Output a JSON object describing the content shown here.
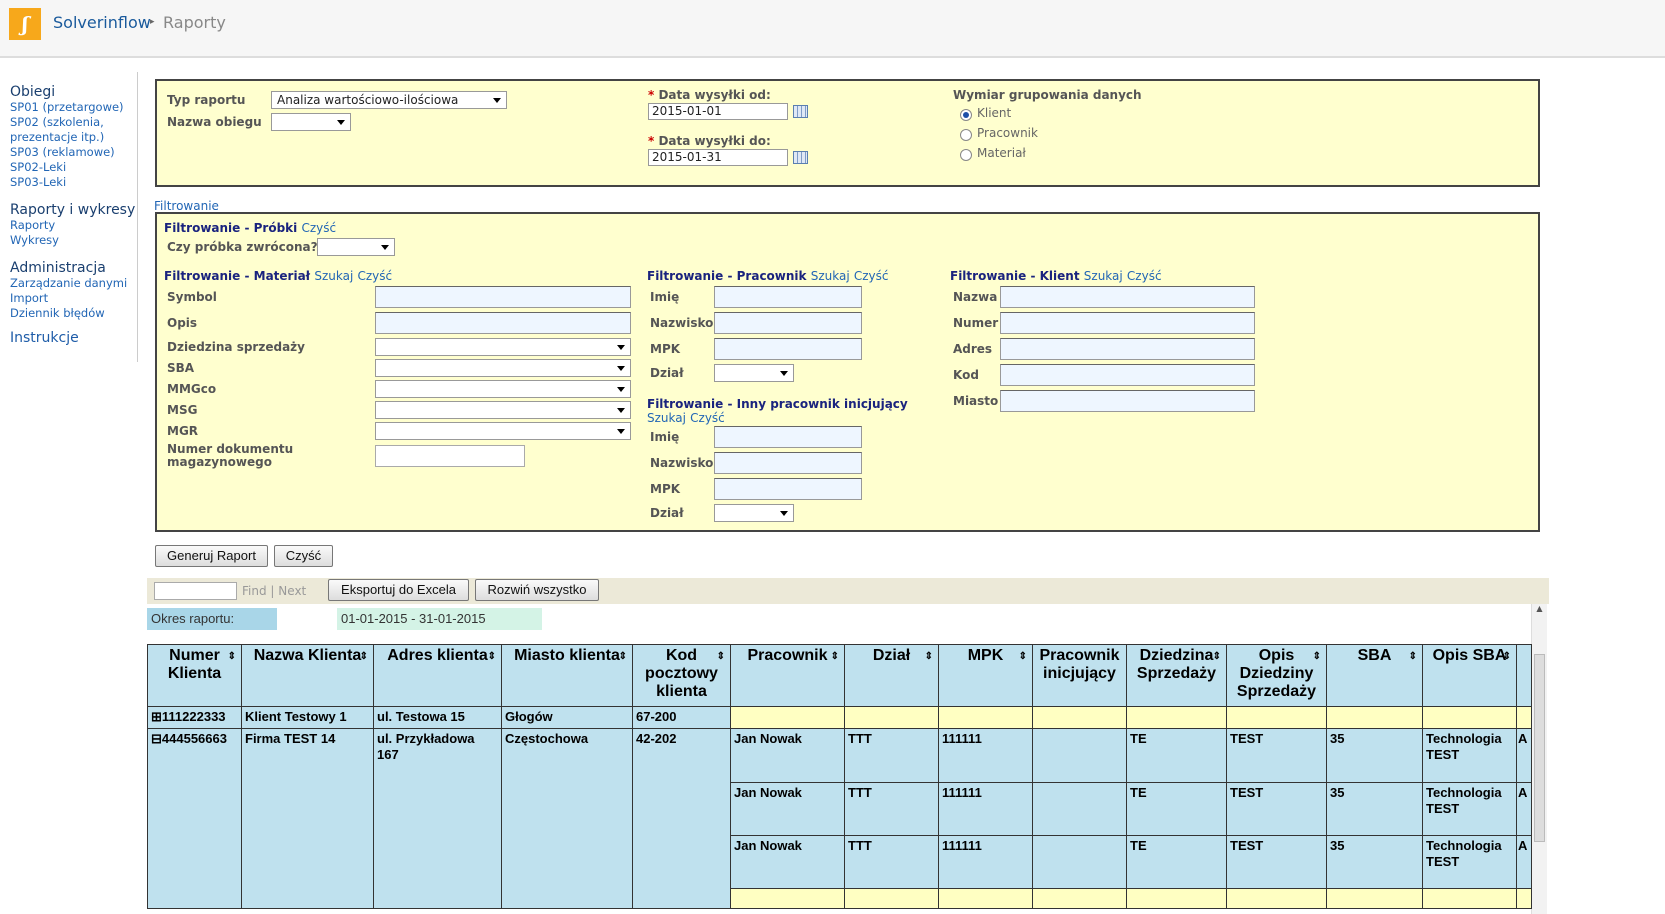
{
  "app": {
    "name": "Solverinflow",
    "page": "Raporty"
  },
  "nav": {
    "obiegi": {
      "title": "Obiegi",
      "items": [
        "SP01 (przetargowe)",
        "SP02 (szkolenia, prezentacje itp.)",
        "SP03 (reklamowe)",
        "SP02-Leki",
        "SP03-Leki"
      ]
    },
    "raporty": {
      "title": "Raporty i wykresy",
      "items": [
        "Raporty",
        "Wykresy"
      ]
    },
    "admin": {
      "title": "Administracja",
      "items": [
        "Zarządzanie danymi",
        "Import",
        "Dziennik błędów"
      ]
    },
    "instr": "Instrukcje"
  },
  "params": {
    "typ_label": "Typ raportu",
    "typ_value": "Analiza wartościowo-ilościowa",
    "nazwa_label": "Nazwa obiegu",
    "od_label": "Data wysyłki od:",
    "od_value": "2015-01-01",
    "do_label": "Data wysyłki do:",
    "do_value": "2015-01-31",
    "wym_label": "Wymiar grupowania danych",
    "radios": [
      "Klient",
      "Pracownik",
      "Materiał"
    ],
    "required_mark": "*"
  },
  "filter": {
    "toggle": "Filtrowanie",
    "probki": "Filtrowanie - Próbki",
    "clear": "Czyść",
    "search": "Szukaj",
    "zwrocona": "Czy próbka zwrócona?",
    "material": "Filtrowanie - Materiał",
    "mat_fields": [
      "Symbol",
      "Opis",
      "Dziedzina sprzedaży",
      "SBA",
      "MMGco",
      "MSG",
      "MGR",
      "Numer dokumentu magazynowego"
    ],
    "pracownik": "Filtrowanie - Pracownik",
    "prac_fields": [
      "Imię",
      "Nazwisko",
      "MPK",
      "Dział"
    ],
    "inny": "Filtrowanie - Inny pracownik inicjujący",
    "klient": "Filtrowanie - Klient",
    "kli_fields": [
      "Nazwa",
      "Numer",
      "Adres",
      "Kod",
      "Miasto"
    ]
  },
  "buttons": {
    "generate": "Generuj Raport",
    "clear": "Czyść",
    "export": "Eksportuj do Excela",
    "expand": "Rozwiń wszystko",
    "find": "Find",
    "next": "Next",
    "sep": "|"
  },
  "report": {
    "period_label": "Okres raportu:",
    "period_value": "01-01-2015 - 31-01-2015"
  },
  "table": {
    "columns": [
      "Numer Klienta",
      "Nazwa Klienta",
      "Adres klienta",
      "Miasto klienta",
      "Kod pocztowy klienta",
      "Pracownik",
      "Dział",
      "MPK",
      "Pracownik inicjujący",
      "Dziedzina Sprzedaży",
      "Opis Dziedziny Sprzedaży",
      "SBA",
      "Opis SBA"
    ],
    "sort_icon": "⇕",
    "rows": [
      {
        "toggle": "⊞",
        "numer": "111222333",
        "nazwa": "Klient Testowy 1",
        "adres": "ul. Testowa 15",
        "miasto": "Głogów",
        "kod": "67-200"
      },
      {
        "toggle": "⊟",
        "numer": "444556663",
        "nazwa": "Firma TEST 14",
        "adres": "ul. Przykładowa 167",
        "miasto": "Częstochowa",
        "kod": "42-202"
      }
    ],
    "detail": [
      {
        "prac": "Jan Nowak",
        "dzial": "TTT",
        "mpk": "111111",
        "inic": "",
        "dziedzina": "TE",
        "opis": "TEST",
        "sba": "35",
        "opis_sba": "Technologia TEST",
        "extra": "A"
      },
      {
        "prac": "Jan Nowak",
        "dzial": "TTT",
        "mpk": "111111",
        "inic": "",
        "dziedzina": "TE",
        "opis": "TEST",
        "sba": "35",
        "opis_sba": "Technologia TEST",
        "extra": "A"
      },
      {
        "prac": "Jan Nowak",
        "dzial": "TTT",
        "mpk": "111111",
        "inic": "",
        "dziedzina": "TE",
        "opis": "TEST",
        "sba": "35",
        "opis_sba": "Technologia TEST",
        "extra": "A"
      }
    ]
  }
}
